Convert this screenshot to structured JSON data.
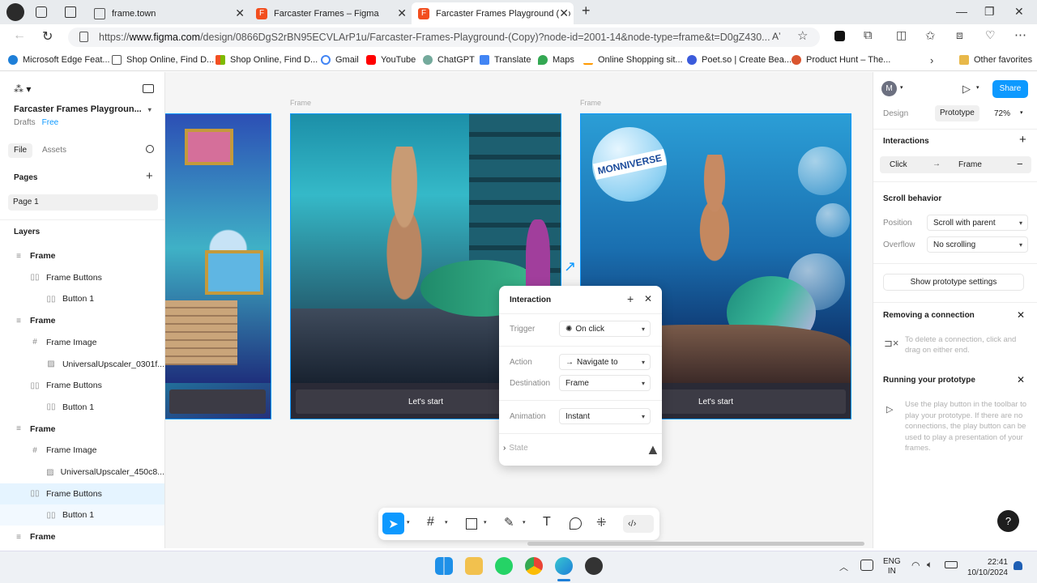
{
  "browser": {
    "tabs": [
      {
        "title": "frame.town",
        "active": false
      },
      {
        "title": "Farcaster Frames – Figma",
        "active": false
      },
      {
        "title": "Farcaster Frames Playground (Co",
        "active": true
      }
    ],
    "url_prefix": "https://",
    "url_domain": "www.figma.com",
    "url_rest": "/design/0866DgS2rBN95ECVLArP1u/Farcaster-Frames-Playground-(Copy)?node-id=2001-14&node-type=frame&t=D0gZ430...",
    "bookmarks": [
      "Microsoft Edge Feat...",
      "Shop Online, Find D...",
      "Shop Online, Find D...",
      "Gmail",
      "YouTube",
      "ChatGPT",
      "Translate",
      "Maps",
      "Online Shopping sit...",
      "Poet.so | Create Bea...",
      "Product Hunt – The..."
    ],
    "other_favorites": "Other favorites"
  },
  "left": {
    "project_title": "Farcaster Frames Playgroun...",
    "drafts": "Drafts",
    "plan": "Free",
    "tab_file": "File",
    "tab_assets": "Assets",
    "pages_label": "Pages",
    "page1": "Page 1",
    "layers_label": "Layers",
    "layers": [
      {
        "name": "Frame",
        "indent": 0,
        "icon": "frame"
      },
      {
        "name": "Frame Buttons",
        "indent": 1,
        "icon": "autolayout"
      },
      {
        "name": "Button 1",
        "indent": 2,
        "icon": "autolayout"
      },
      {
        "name": "Frame",
        "indent": 0,
        "icon": "frame"
      },
      {
        "name": "Frame Image",
        "indent": 1,
        "icon": "hash"
      },
      {
        "name": "UniversalUpscaler_0301f...",
        "indent": 2,
        "icon": "image"
      },
      {
        "name": "Frame Buttons",
        "indent": 1,
        "icon": "autolayout"
      },
      {
        "name": "Button 1",
        "indent": 2,
        "icon": "autolayout"
      },
      {
        "name": "Frame",
        "indent": 0,
        "icon": "frame"
      },
      {
        "name": "Frame Image",
        "indent": 1,
        "icon": "hash"
      },
      {
        "name": "UniversalUpscaler_450c8...",
        "indent": 2,
        "icon": "image"
      },
      {
        "name": "Frame Buttons",
        "indent": 1,
        "icon": "autolayout",
        "selected": true
      },
      {
        "name": "Button 1",
        "indent": 2,
        "icon": "autolayout",
        "subselected": true
      },
      {
        "name": "Frame",
        "indent": 0,
        "icon": "frame"
      }
    ]
  },
  "canvas": {
    "frame_label_1": "Frame",
    "frame_label_2": "Frame",
    "button_label_2": "Let's start",
    "button_label_3": "Let's start",
    "bubble_text": "MONNIVERSE"
  },
  "popup": {
    "title": "Interaction",
    "trigger_label": "Trigger",
    "trigger_value": "On click",
    "action_label": "Action",
    "action_value": "Navigate to",
    "destination_label": "Destination",
    "destination_value": "Frame",
    "animation_label": "Animation",
    "animation_value": "Instant",
    "state_label": "State"
  },
  "right": {
    "avatar_letter": "M",
    "share": "Share",
    "tab_design": "Design",
    "tab_prototype": "Prototype",
    "zoom": "72%",
    "interactions_label": "Interactions",
    "interaction_trigger": "Click",
    "interaction_target": "Frame",
    "scroll_behavior": "Scroll behavior",
    "position_label": "Position",
    "position_value": "Scroll with parent",
    "overflow_label": "Overflow",
    "overflow_value": "No scrolling",
    "show_proto_settings": "Show prototype settings",
    "removing_title": "Removing a connection",
    "removing_text": "To delete a connection, click and drag on either end.",
    "running_title": "Running your prototype",
    "running_text": "Use the play button in the toolbar to play your prototype. If there are no connections, the play button can be used to play a presentation of your frames."
  },
  "taskbar": {
    "lang1": "ENG",
    "lang2": "IN",
    "time": "22:41",
    "date": "10/10/2024"
  },
  "colors": {
    "accent": "#0d99ff",
    "selected_row": "#e5f4ff",
    "button_dark": "#3c3b45"
  }
}
